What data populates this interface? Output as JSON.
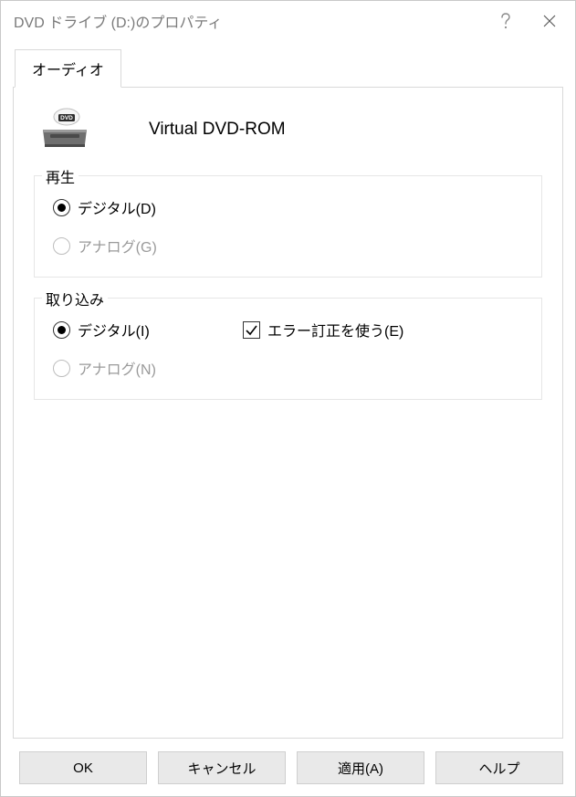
{
  "window": {
    "title": "DVD ドライブ (D:)のプロパティ"
  },
  "tabs": {
    "audio": "オーディオ"
  },
  "device": {
    "name": "Virtual DVD-ROM"
  },
  "playback": {
    "legend": "再生",
    "digital": "デジタル(D)",
    "analog": "アナログ(G)"
  },
  "capture": {
    "legend": "取り込み",
    "digital": "デジタル(I)",
    "analog": "アナログ(N)",
    "error_correction": "エラー訂正を使う(E)"
  },
  "buttons": {
    "ok": "OK",
    "cancel": "キャンセル",
    "apply": "適用(A)",
    "help": "ヘルプ"
  }
}
